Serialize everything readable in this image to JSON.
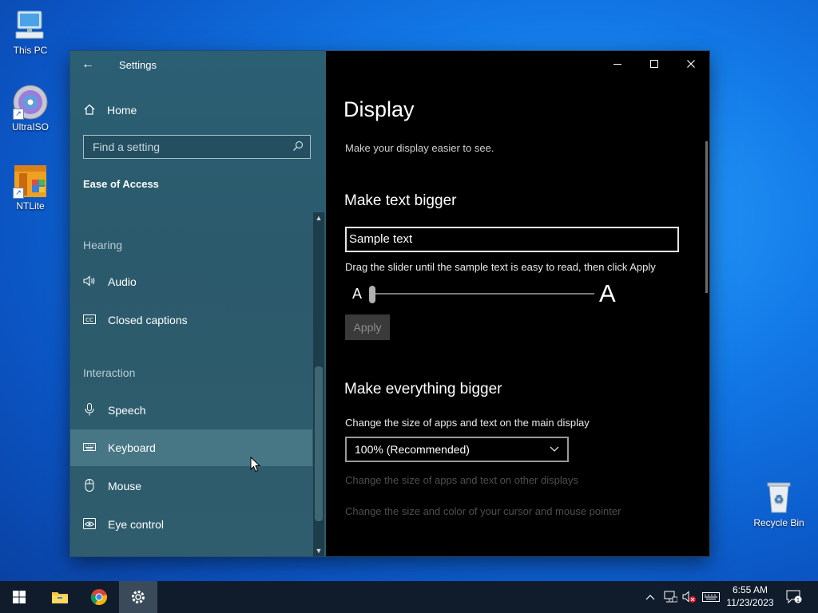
{
  "desktop": {
    "icons": [
      {
        "label": "This PC"
      },
      {
        "label": "UltraISO"
      },
      {
        "label": "NTLite"
      },
      {
        "label": "Recycle Bin"
      }
    ]
  },
  "window": {
    "app_title": "Settings",
    "controls": {
      "minimize": "minimize-icon",
      "maximize": "maximize-icon",
      "close": "close-icon"
    }
  },
  "sidebar": {
    "home_label": "Home",
    "search_placeholder": "Find a setting",
    "category": "Ease of Access",
    "sections": [
      {
        "title": "Hearing",
        "items": [
          {
            "label": "Audio",
            "icon": "speaker-icon"
          },
          {
            "label": "Closed captions",
            "icon": "cc-icon"
          }
        ]
      },
      {
        "title": "Interaction",
        "items": [
          {
            "label": "Speech",
            "icon": "microphone-icon"
          },
          {
            "label": "Keyboard",
            "icon": "keyboard-icon",
            "selected": true
          },
          {
            "label": "Mouse",
            "icon": "mouse-icon"
          },
          {
            "label": "Eye control",
            "icon": "eye-icon"
          }
        ]
      }
    ]
  },
  "main": {
    "title": "Display",
    "description": "Make your display easier to see.",
    "text_bigger": {
      "heading": "Make text bigger",
      "sample": "Sample text",
      "hint": "Drag the slider until the sample text is easy to read, then click Apply",
      "small_a": "A",
      "big_a": "A",
      "apply_label": "Apply",
      "slider_value_percent": 100
    },
    "everything_bigger": {
      "heading": "Make everything bigger",
      "size_label": "Change the size of apps and text on the main display",
      "size_value": "100% (Recommended)",
      "other_displays_link": "Change the size of apps and text on other displays",
      "cursor_link": "Change the size and color of your cursor and mouse pointer"
    }
  },
  "taskbar": {
    "time": "6:55 AM",
    "date": "11/23/2023",
    "pinned": [
      "start-icon",
      "file-explorer-icon",
      "chrome-icon",
      "settings-icon"
    ]
  }
}
